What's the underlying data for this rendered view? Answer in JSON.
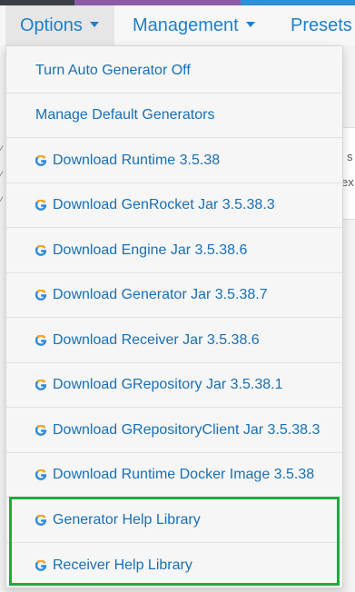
{
  "nav": {
    "options_label": "Options",
    "management_label": "Management",
    "presets_label": "Presets"
  },
  "background": {
    "right_text_1": "s",
    "right_text_2": "ex"
  },
  "menu": {
    "items": [
      {
        "label": "Turn Auto Generator Off",
        "icon": null
      },
      {
        "label": "Manage Default Generators",
        "icon": null
      },
      {
        "label": "Download Runtime 3.5.38",
        "icon": "genrocket-g-icon"
      },
      {
        "label": "Download GenRocket Jar 3.5.38.3",
        "icon": "genrocket-g-icon"
      },
      {
        "label": "Download Engine Jar 3.5.38.6",
        "icon": "genrocket-g-icon"
      },
      {
        "label": "Download Generator Jar 3.5.38.7",
        "icon": "genrocket-g-icon"
      },
      {
        "label": "Download Receiver Jar 3.5.38.6",
        "icon": "genrocket-g-icon"
      },
      {
        "label": "Download GRepository Jar 3.5.38.1",
        "icon": "genrocket-g-icon"
      },
      {
        "label": "Download GRepositoryClient Jar 3.5.38.3",
        "icon": "genrocket-g-icon"
      },
      {
        "label": "Download Runtime Docker Image 3.5.38",
        "icon": "genrocket-g-icon"
      },
      {
        "label": "Generator Help Library",
        "icon": "genrocket-g-icon"
      },
      {
        "label": "Receiver Help Library",
        "icon": "genrocket-g-icon"
      }
    ]
  },
  "colors": {
    "link": "#1a6fb4",
    "highlight": "#1faa3f",
    "icon_orange": "#f5a623",
    "icon_blue": "#2e8ad8"
  }
}
